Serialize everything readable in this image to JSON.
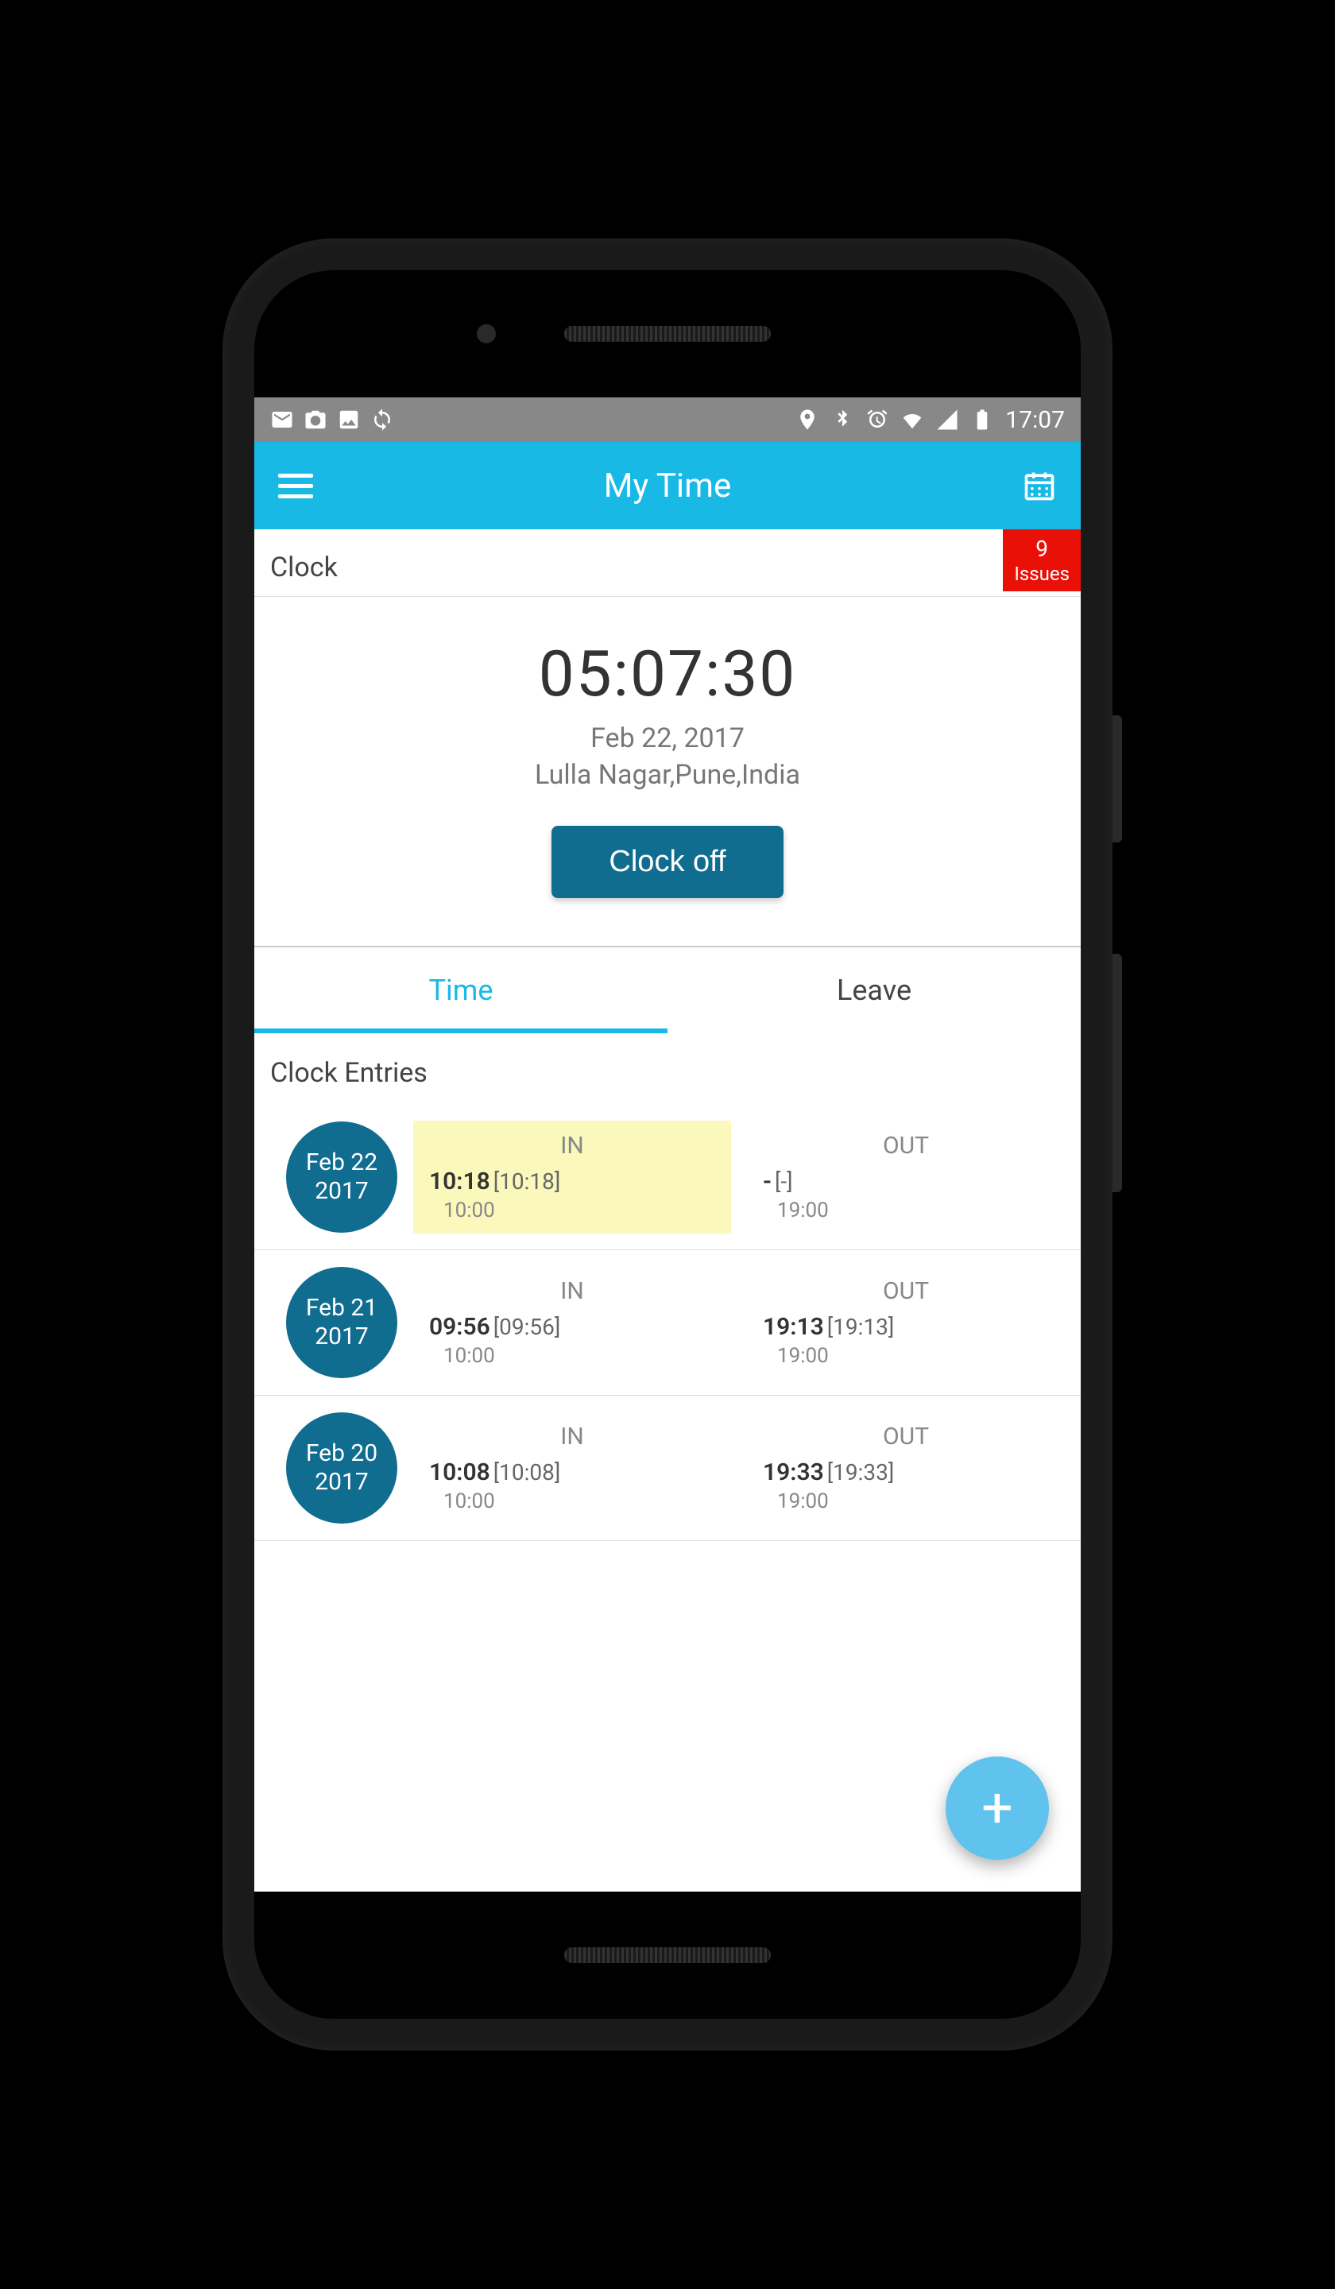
{
  "statusbar": {
    "time": "17:07"
  },
  "appbar": {
    "title": "My Time"
  },
  "clock": {
    "section_label": "Clock",
    "issues_count": "9",
    "issues_label": "Issues",
    "time": "05:07:30",
    "date": "Feb 22, 2017",
    "location": "Lulla Nagar,Pune,India",
    "button_label": "Clock off"
  },
  "tabs": {
    "time": "Time",
    "leave": "Leave"
  },
  "entries": {
    "header": "Clock Entries",
    "in_label": "IN",
    "out_label": "OUT",
    "rows": [
      {
        "date_top": "Feb 22",
        "date_bottom": "2017",
        "in_time": "10:18",
        "in_bracket": "[10:18]",
        "in_sched": "10:00",
        "out_time": "-",
        "out_bracket": "[-]",
        "out_sched": "19:00",
        "highlighted": true
      },
      {
        "date_top": "Feb 21",
        "date_bottom": "2017",
        "in_time": "09:56",
        "in_bracket": "[09:56]",
        "in_sched": "10:00",
        "out_time": "19:13",
        "out_bracket": "[19:13]",
        "out_sched": "19:00",
        "highlighted": false
      },
      {
        "date_top": "Feb 20",
        "date_bottom": "2017",
        "in_time": "10:08",
        "in_bracket": "[10:08]",
        "in_sched": "10:00",
        "out_time": "19:33",
        "out_bracket": "[19:33]",
        "out_sched": "19:00",
        "highlighted": false
      }
    ]
  }
}
